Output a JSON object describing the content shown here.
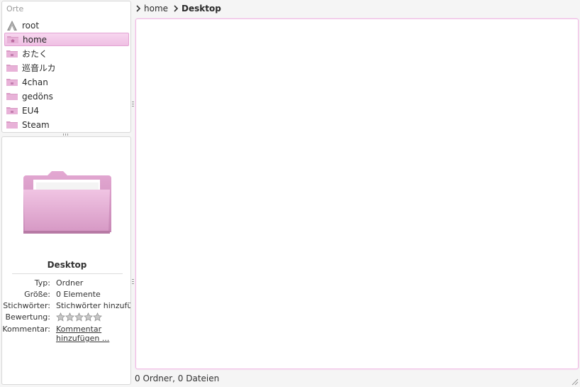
{
  "places": {
    "title": "Orte",
    "items": [
      {
        "label": "root",
        "icon": "root-drive-icon",
        "selected": false
      },
      {
        "label": "home",
        "icon": "home-folder-icon",
        "selected": true
      },
      {
        "label": "おたく",
        "icon": "folder-icon",
        "selected": false
      },
      {
        "label": "巡音ルカ",
        "icon": "folder-icon",
        "selected": false
      },
      {
        "label": "4chan",
        "icon": "folder-icon",
        "selected": false
      },
      {
        "label": "gedöns",
        "icon": "folder-icon",
        "selected": false
      },
      {
        "label": "EU4",
        "icon": "folder-icon",
        "selected": false
      },
      {
        "label": "Steam",
        "icon": "folder-icon",
        "selected": false
      }
    ]
  },
  "info": {
    "name": "Desktop",
    "type_key": "Typ:",
    "type_val": "Ordner",
    "size_key": "Größe:",
    "size_val": "0 Elemente",
    "tags_key": "Stichwörter:",
    "tags_val": "Stichwörter hinzufü",
    "rating_key": "Bewertung:",
    "rating_stars": 0,
    "rating_max": 5,
    "comment_key": "Kommentar:",
    "comment_line1": "Kommentar",
    "comment_line2": "hinzufügen ..."
  },
  "breadcrumb": {
    "items": [
      "home",
      "Desktop"
    ]
  },
  "status": {
    "text": "0 Ordner, 0 Dateien"
  },
  "colors": {
    "accent": "#efbfe3",
    "folder": "#dc9ec8",
    "link": "#1c5fa8"
  }
}
